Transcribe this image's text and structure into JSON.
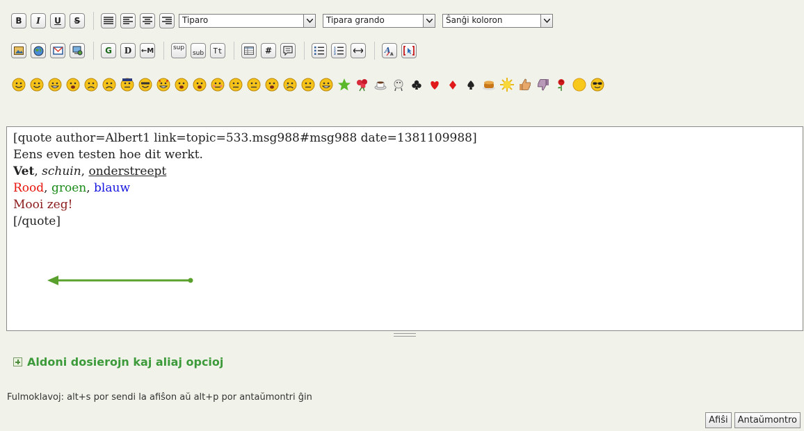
{
  "toolbar": {
    "bold_label": "B",
    "italic_label": "I",
    "underline_label": "U",
    "strike_label": "S",
    "glow_label": "G",
    "shadow_label": "D",
    "move_label": "←M",
    "sup_label": "sup",
    "sub_label": "sub",
    "tt_label": "Tt",
    "code_label": "#",
    "font_face": "Tiparo",
    "font_size": "Tipara grando",
    "font_color": "Ŝanĝi koloron"
  },
  "editor": {
    "line1": "[quote author=Albert1 link=topic=533.msg988#msg988 date=1381109988]",
    "line2": "Eens even testen hoe dit werkt.",
    "bold_word": "Vet",
    "italic_word": "schuin",
    "underline_word": "onderstreept",
    "sep": ", ",
    "red_word": "Rood",
    "green_word": "groen",
    "blue_word": "blauw",
    "line5": "Mooi zeg!",
    "line6": "[/quote]"
  },
  "more_options": "Aldoni dosierojn kaj aliaj opcioj",
  "hint": "Fulmoklavoj: alt+s por sendi la afiŝon aŭ alt+p por antaŭmontri ĝin",
  "buttons": {
    "post": "Afiŝi",
    "preview": "Antaŭmontro"
  },
  "colors": {
    "red": "#e8140c",
    "green": "#1a8a18",
    "blue": "#1414e0",
    "maroon": "#8b1a1a",
    "arrow": "#5aa02c",
    "link_green": "#3d9a3a"
  },
  "smileys": [
    "smiley",
    "wink",
    "cheesy",
    "grin",
    "angry",
    "sad",
    "police",
    "cool-shades",
    "devil",
    "shocked",
    "tongue",
    "embarrassed",
    "lips-sealed",
    "undecided",
    "kiss",
    "cry",
    "rolleyes",
    "laugh",
    "star",
    "flowers",
    "coffee",
    "sheep",
    "club",
    "heart",
    "diamond",
    "spade",
    "cake",
    "sun",
    "thumbs-up",
    "thumbs-down",
    "rose",
    "sun-face",
    "sunglasses"
  ]
}
